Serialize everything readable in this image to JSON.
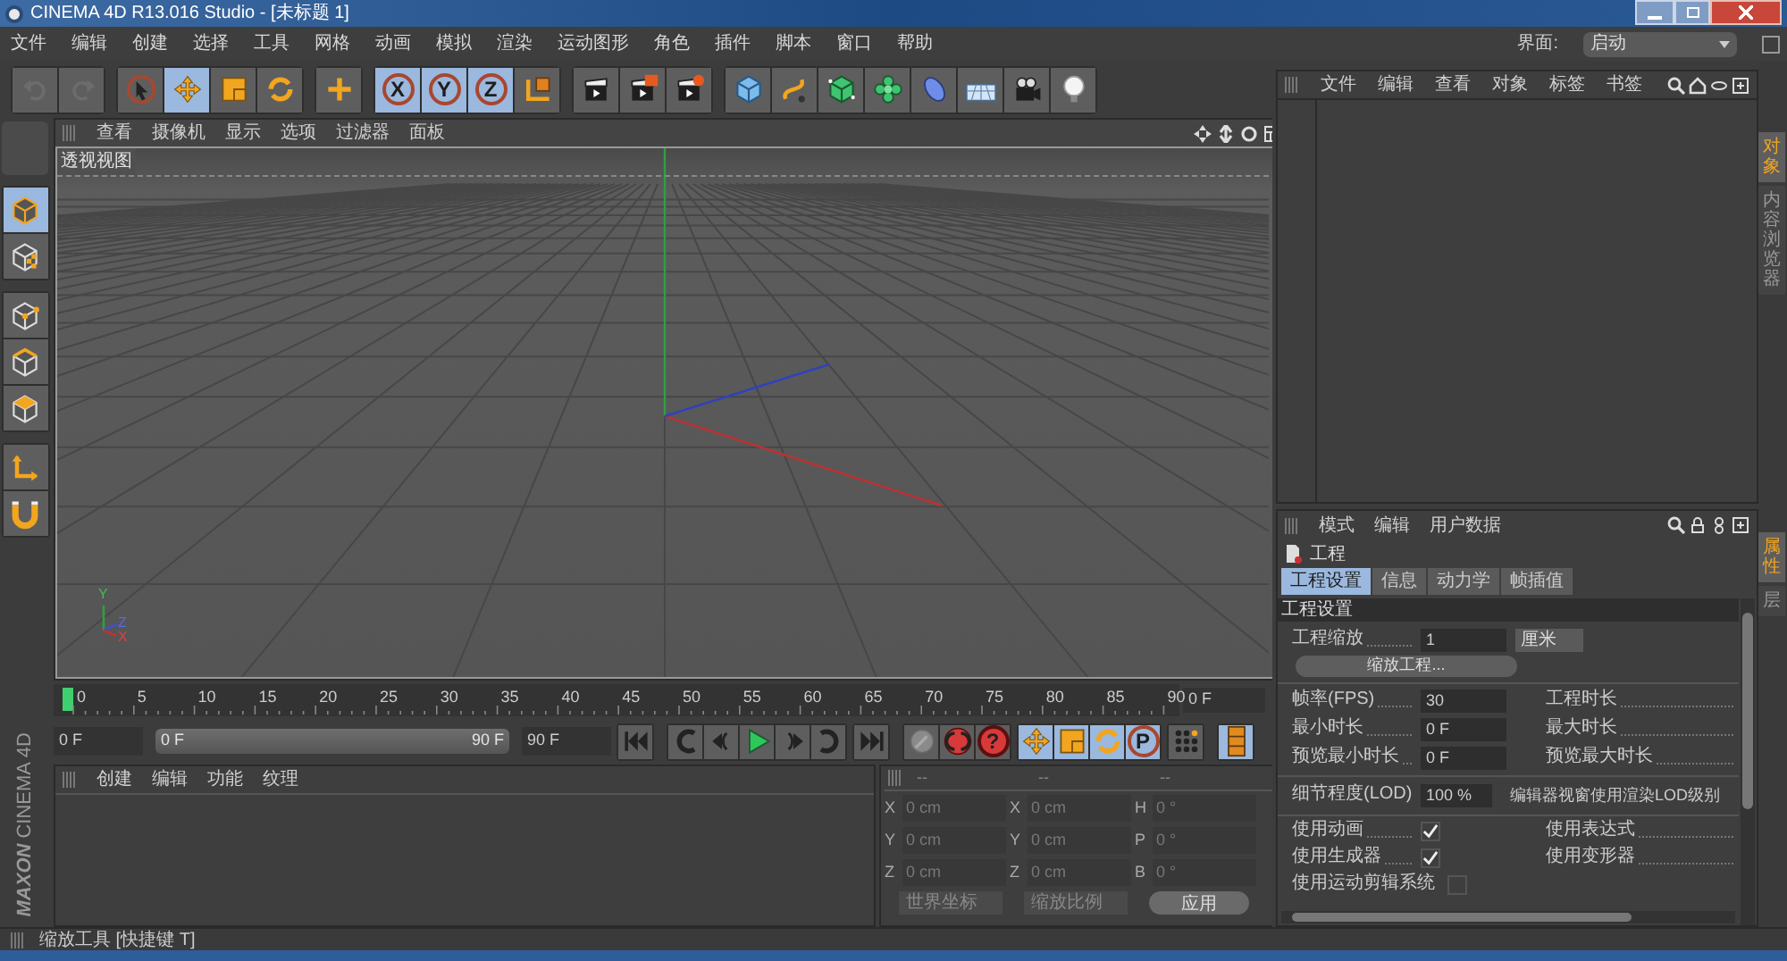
{
  "window": {
    "title": "CINEMA 4D R13.016 Studio - [未标题 1]"
  },
  "menu_bar": [
    "文件",
    "编辑",
    "创建",
    "选择",
    "工具",
    "网格",
    "动画",
    "模拟",
    "渲染",
    "运动图形",
    "角色",
    "插件",
    "脚本",
    "窗口",
    "帮助"
  ],
  "layout_selector": {
    "label": "界面:",
    "value": "启动"
  },
  "toolbar": [
    {
      "tools": [
        {
          "kind": "undo",
          "selected": false
        },
        {
          "kind": "redo",
          "selected": false
        }
      ]
    },
    {
      "tools": [
        {
          "kind": "pointer",
          "selected": false
        },
        {
          "kind": "move",
          "selected": true
        },
        {
          "kind": "scale",
          "selected": false
        },
        {
          "kind": "rotate",
          "selected": false
        }
      ]
    },
    {
      "tools": [
        {
          "kind": "add",
          "selected": false
        }
      ]
    },
    {
      "tools": [
        {
          "kind": "axis",
          "label": "X",
          "selected": true
        },
        {
          "kind": "axis",
          "label": "Y",
          "selected": true
        },
        {
          "kind": "axis",
          "label": "Z",
          "selected": true
        },
        {
          "kind": "coords",
          "selected": false
        }
      ]
    },
    {
      "tools": [
        {
          "kind": "render_view",
          "selected": false
        },
        {
          "kind": "render_picture",
          "selected": false
        },
        {
          "kind": "render_settings",
          "selected": false
        }
      ]
    },
    {
      "tools": [
        {
          "kind": "cube",
          "selected": false
        },
        {
          "kind": "spline",
          "selected": false
        },
        {
          "kind": "nurbs",
          "selected": false
        },
        {
          "kind": "array",
          "selected": false
        },
        {
          "kind": "deformer",
          "selected": false
        },
        {
          "kind": "floor",
          "selected": false
        },
        {
          "kind": "camera",
          "selected": false
        },
        {
          "kind": "light",
          "selected": false
        }
      ]
    }
  ],
  "mode_toolbar": [
    {
      "tools": [
        {
          "kind": "model",
          "selected": true
        },
        {
          "kind": "texture",
          "selected": false
        }
      ]
    },
    {
      "tools": [
        {
          "kind": "points",
          "selected": false
        },
        {
          "kind": "edges",
          "selected": false
        },
        {
          "kind": "polygons",
          "selected": false
        }
      ]
    },
    {
      "tools": [
        {
          "kind": "axis_mode",
          "selected": false
        },
        {
          "kind": "snap",
          "selected": false
        }
      ]
    }
  ],
  "viewport": {
    "menu": [
      "查看",
      "摄像机",
      "显示",
      "选项",
      "过滤器",
      "面板"
    ],
    "label": "透视视图",
    "gizmo": {
      "y": "Y",
      "z": "Z",
      "x": "X"
    }
  },
  "timeline": {
    "ticks": [
      "0",
      "5",
      "10",
      "15",
      "20",
      "25",
      "30",
      "35",
      "40",
      "45",
      "50",
      "55",
      "60",
      "65",
      "70",
      "75",
      "80",
      "85",
      "90"
    ],
    "current_frame": "0 F"
  },
  "transport": {
    "start": "0 F",
    "range": {
      "start": "0 F",
      "end": "90 F",
      "level": 1
    },
    "end": "90 F",
    "buttons": [
      {
        "kind": "first",
        "selected": false
      },
      {
        "kind": "prevkey",
        "selected": false
      },
      {
        "kind": "prevframe",
        "selected": false
      },
      {
        "kind": "play",
        "selected": false
      },
      {
        "kind": "nextframe",
        "selected": false
      },
      {
        "kind": "nextkey",
        "selected": false
      },
      {
        "kind": "last",
        "selected": false
      },
      {
        "kind": "keyframe",
        "selected": false
      },
      {
        "kind": "autokey",
        "selected": false
      },
      {
        "kind": "help",
        "label": "?",
        "selected": false
      },
      {
        "kind": "move",
        "selected": true
      },
      {
        "kind": "scale",
        "selected": true
      },
      {
        "kind": "rotate",
        "selected": true
      },
      {
        "kind": "param",
        "label": "P",
        "selected": true
      },
      {
        "kind": "pla",
        "selected": false
      },
      {
        "kind": "film",
        "selected": true
      }
    ]
  },
  "brand": {
    "company": "MAXON",
    "product": "CINEMA 4D"
  },
  "material_manager": {
    "menu": [
      "创建",
      "编辑",
      "功能",
      "纹理"
    ]
  },
  "coordinates": {
    "headers": [
      "--",
      "--",
      "--"
    ],
    "rows": [
      {
        "axis": "X",
        "position": "0 cm",
        "size_axis": "X",
        "size": "0 cm",
        "rotation_axis": "H",
        "rotation": "0 °"
      },
      {
        "axis": "Y",
        "position": "0 cm",
        "size_axis": "Y",
        "size": "0 cm",
        "rotation_axis": "P",
        "rotation": "0 °"
      },
      {
        "axis": "Z",
        "position": "0 cm",
        "size_axis": "Z",
        "size": "0 cm",
        "rotation_axis": "B",
        "rotation": "0 °"
      }
    ],
    "space": "世界坐标",
    "scale_mode": "缩放比例",
    "apply": "应用"
  },
  "object_manager": {
    "menu": [
      "文件",
      "编辑",
      "查看",
      "对象",
      "标签",
      "书签"
    ]
  },
  "side_tabs_top": [
    {
      "label": "对象",
      "selected": true
    },
    {
      "label": "内容浏览器",
      "selected": false
    }
  ],
  "side_tabs_bottom": [
    {
      "label": "属性",
      "selected": true
    },
    {
      "label": "层",
      "selected": false
    }
  ],
  "attributes": {
    "menu": [
      "模式",
      "编辑",
      "用户数据"
    ],
    "title": "工程",
    "tabs": [
      {
        "label": "工程设置",
        "selected": true
      },
      {
        "label": "信息",
        "selected": false
      },
      {
        "label": "动力学",
        "selected": false
      },
      {
        "label": "帧插值",
        "selected": false
      }
    ],
    "section": "工程设置",
    "scale": {
      "label": "工程缩放",
      "value": "1",
      "unit": "厘米"
    },
    "scale_button": "缩放工程...",
    "time_rows": [
      {
        "label": "帧率(FPS)",
        "value": "30",
        "right_label": "工程时长"
      },
      {
        "label": "最小时长",
        "value": "0 F",
        "right_label": "最大时长"
      },
      {
        "label": "预览最小时长",
        "value": "0 F",
        "right_label": "预览最大时长"
      }
    ],
    "lod": {
      "label": "细节程度(LOD)",
      "value": "100 %",
      "right_label": "编辑器视窗使用渲染LOD级别"
    },
    "flags": [
      {
        "label": "使用动画",
        "checked": true,
        "right_label": "使用表达式"
      },
      {
        "label": "使用生成器",
        "checked": true,
        "right_label": "使用变形器"
      },
      {
        "label": "使用运动剪辑系统",
        "checked": false
      }
    ]
  },
  "status_bar": "缩放工具 [快捷键 T]"
}
